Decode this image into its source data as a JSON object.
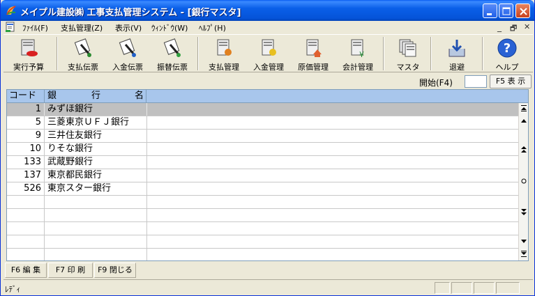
{
  "window": {
    "title": "メイプル建設㈱ 工事支払管理システム - [銀行マスタ]"
  },
  "menu": [
    {
      "label": "ﾌｧｲﾙ(F)"
    },
    {
      "label": "支払管理(Z)"
    },
    {
      "label": "表示(V)"
    },
    {
      "label": "ｳｨﾝﾄﾞｳ(W)"
    },
    {
      "label": "ﾍﾙﾌﾟ(H)"
    }
  ],
  "mdi_controls": {
    "minimize": "_",
    "restore": "🗗",
    "close": "✕"
  },
  "toolbar": [
    {
      "label": "実行予算",
      "icon": "budget-icon"
    },
    {
      "label": "支払伝票",
      "icon": "payment-slip-icon"
    },
    {
      "label": "入金伝票",
      "icon": "deposit-slip-icon"
    },
    {
      "label": "振替伝票",
      "icon": "transfer-slip-icon"
    },
    {
      "label": "支払管理",
      "icon": "payment-management-icon"
    },
    {
      "label": "入金管理",
      "icon": "deposit-management-icon"
    },
    {
      "label": "原価管理",
      "icon": "cost-management-icon"
    },
    {
      "label": "会計管理",
      "icon": "accounting-icon"
    },
    {
      "label": "マスタ",
      "icon": "master-icon"
    },
    {
      "label": "退避",
      "icon": "backup-icon"
    },
    {
      "label": "ヘルプ",
      "icon": "help-icon"
    }
  ],
  "start": {
    "label": "開始(F4)",
    "value": "",
    "f5_label": "F5 表 示"
  },
  "grid": {
    "headers": {
      "code": "コード",
      "name_chars": [
        "銀",
        "行",
        "名"
      ]
    },
    "rows": [
      {
        "code": "1",
        "name": "みずほ銀行"
      },
      {
        "code": "5",
        "name": "三菱東京ＵＦＪ銀行"
      },
      {
        "code": "9",
        "name": "三井住友銀行"
      },
      {
        "code": "10",
        "name": "りそな銀行"
      },
      {
        "code": "133",
        "name": "武蔵野銀行"
      },
      {
        "code": "137",
        "name": "東京都民銀行"
      },
      {
        "code": "526",
        "name": "東京スター銀行"
      },
      {
        "code": "",
        "name": ""
      },
      {
        "code": "",
        "name": ""
      },
      {
        "code": "",
        "name": ""
      },
      {
        "code": "",
        "name": ""
      },
      {
        "code": "",
        "name": ""
      }
    ]
  },
  "function_keys": [
    {
      "label": "F6 編 集"
    },
    {
      "label": "F7 印 刷"
    },
    {
      "label": "F9 閉じる"
    }
  ],
  "status": {
    "text": "ﾚﾃﾞｨ"
  }
}
